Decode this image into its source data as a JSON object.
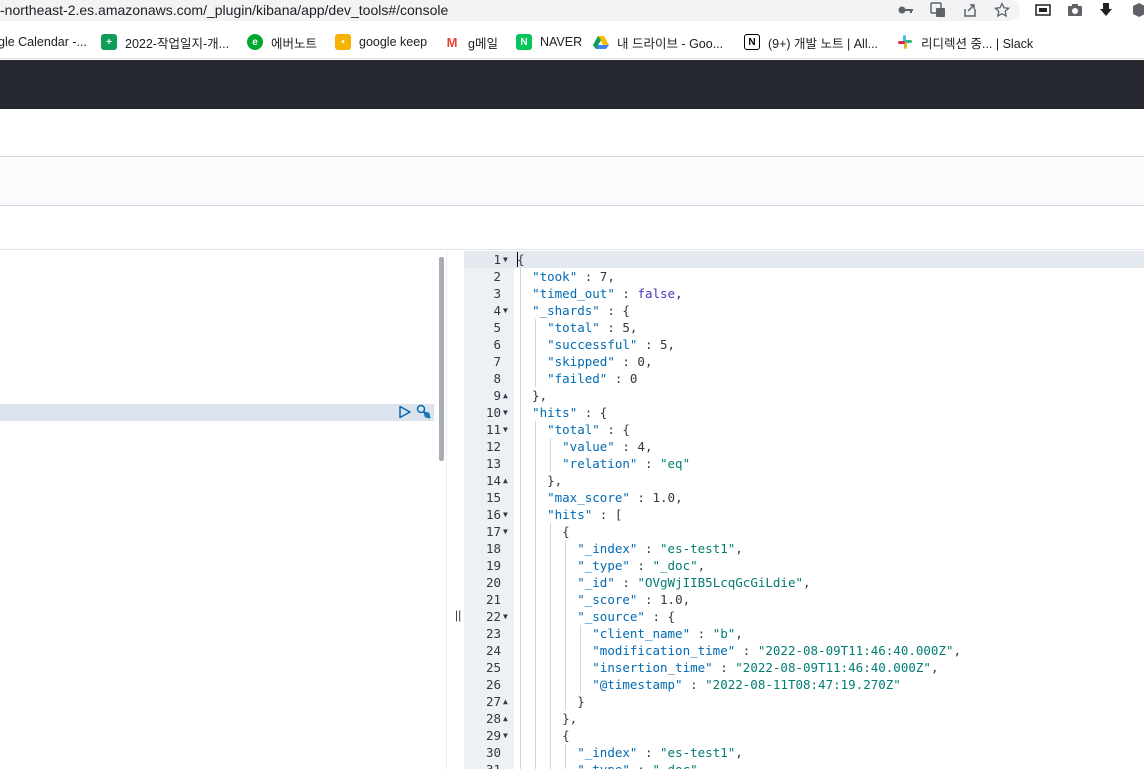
{
  "browser": {
    "url": "-northeast-2.es.amazonaws.com/_plugin/kibana/app/dev_tools#/console",
    "icons": [
      "key-icon",
      "translate-icon",
      "share-icon",
      "star-icon",
      "media-icon",
      "camera-icon",
      "download-icon",
      "extension-icon"
    ]
  },
  "bookmarks": [
    {
      "label": "gle Calendar -...",
      "icon": "calendar-icon",
      "color": ""
    },
    {
      "label": "2022-작업일지-개...",
      "icon": "sheets-icon",
      "color": "#0f9d58",
      "glyph": "+"
    },
    {
      "label": "에버노트",
      "icon": "evernote-icon",
      "color": "#00a82d",
      "glyph": "E"
    },
    {
      "label": "google keep",
      "icon": "keep-icon",
      "color": "#f4b400",
      "glyph": "•"
    },
    {
      "label": "g메일",
      "icon": "gmail-icon",
      "color": "#ea4335",
      "glyph": "M"
    },
    {
      "label": "NAVER",
      "icon": "naver-icon",
      "color": "#03c75a",
      "glyph": "N"
    },
    {
      "label": "내 드라이브 - Goo...",
      "icon": "drive-icon",
      "color": "#4285f4",
      "glyph": "▲"
    },
    {
      "label": "(9+) 개발 노트 | All...",
      "icon": "notion-icon",
      "color": "#000000",
      "glyph": "N"
    },
    {
      "label": "리디렉션 중... | Slack",
      "icon": "slack-icon",
      "color": "#e01e5a",
      "glyph": "#"
    }
  ],
  "output": {
    "lines": [
      {
        "n": "1",
        "fold": "down",
        "segs": [
          [
            "p",
            "{"
          ]
        ]
      },
      {
        "n": "2",
        "fold": "",
        "segs": [
          [
            "p",
            "  "
          ],
          [
            "k",
            "\"took\""
          ],
          [
            "p",
            " : "
          ],
          [
            "n",
            "7"
          ],
          [
            "p",
            ","
          ]
        ]
      },
      {
        "n": "3",
        "fold": "",
        "segs": [
          [
            "p",
            "  "
          ],
          [
            "k",
            "\"timed_out\""
          ],
          [
            "p",
            " : "
          ],
          [
            "b",
            "false"
          ],
          [
            "p",
            ","
          ]
        ]
      },
      {
        "n": "4",
        "fold": "down",
        "segs": [
          [
            "p",
            "  "
          ],
          [
            "k",
            "\"_shards\""
          ],
          [
            "p",
            " : {"
          ]
        ]
      },
      {
        "n": "5",
        "fold": "",
        "segs": [
          [
            "p",
            "    "
          ],
          [
            "k",
            "\"total\""
          ],
          [
            "p",
            " : "
          ],
          [
            "n",
            "5"
          ],
          [
            "p",
            ","
          ]
        ]
      },
      {
        "n": "6",
        "fold": "",
        "segs": [
          [
            "p",
            "    "
          ],
          [
            "k",
            "\"successful\""
          ],
          [
            "p",
            " : "
          ],
          [
            "n",
            "5"
          ],
          [
            "p",
            ","
          ]
        ]
      },
      {
        "n": "7",
        "fold": "",
        "segs": [
          [
            "p",
            "    "
          ],
          [
            "k",
            "\"skipped\""
          ],
          [
            "p",
            " : "
          ],
          [
            "n",
            "0"
          ],
          [
            "p",
            ","
          ]
        ]
      },
      {
        "n": "8",
        "fold": "",
        "segs": [
          [
            "p",
            "    "
          ],
          [
            "k",
            "\"failed\""
          ],
          [
            "p",
            " : "
          ],
          [
            "n",
            "0"
          ]
        ]
      },
      {
        "n": "9",
        "fold": "up",
        "segs": [
          [
            "p",
            "  },"
          ]
        ]
      },
      {
        "n": "10",
        "fold": "down",
        "segs": [
          [
            "p",
            "  "
          ],
          [
            "k",
            "\"hits\""
          ],
          [
            "p",
            " : {"
          ]
        ]
      },
      {
        "n": "11",
        "fold": "down",
        "segs": [
          [
            "p",
            "    "
          ],
          [
            "k",
            "\"total\""
          ],
          [
            "p",
            " : {"
          ]
        ]
      },
      {
        "n": "12",
        "fold": "",
        "segs": [
          [
            "p",
            "      "
          ],
          [
            "k",
            "\"value\""
          ],
          [
            "p",
            " : "
          ],
          [
            "n",
            "4"
          ],
          [
            "p",
            ","
          ]
        ]
      },
      {
        "n": "13",
        "fold": "",
        "segs": [
          [
            "p",
            "      "
          ],
          [
            "k",
            "\"relation\""
          ],
          [
            "p",
            " : "
          ],
          [
            "s",
            "\"eq\""
          ]
        ]
      },
      {
        "n": "14",
        "fold": "up",
        "segs": [
          [
            "p",
            "    },"
          ]
        ]
      },
      {
        "n": "15",
        "fold": "",
        "segs": [
          [
            "p",
            "    "
          ],
          [
            "k",
            "\"max_score\""
          ],
          [
            "p",
            " : "
          ],
          [
            "n",
            "1.0"
          ],
          [
            "p",
            ","
          ]
        ]
      },
      {
        "n": "16",
        "fold": "down",
        "segs": [
          [
            "p",
            "    "
          ],
          [
            "k",
            "\"hits\""
          ],
          [
            "p",
            " : ["
          ]
        ]
      },
      {
        "n": "17",
        "fold": "down",
        "segs": [
          [
            "p",
            "      {"
          ]
        ]
      },
      {
        "n": "18",
        "fold": "",
        "segs": [
          [
            "p",
            "        "
          ],
          [
            "k",
            "\"_index\""
          ],
          [
            "p",
            " : "
          ],
          [
            "s",
            "\"es-test1\""
          ],
          [
            "p",
            ","
          ]
        ]
      },
      {
        "n": "19",
        "fold": "",
        "segs": [
          [
            "p",
            "        "
          ],
          [
            "k",
            "\"_type\""
          ],
          [
            "p",
            " : "
          ],
          [
            "s",
            "\"_doc\""
          ],
          [
            "p",
            ","
          ]
        ]
      },
      {
        "n": "20",
        "fold": "",
        "segs": [
          [
            "p",
            "        "
          ],
          [
            "k",
            "\"_id\""
          ],
          [
            "p",
            " : "
          ],
          [
            "s",
            "\"OVgWjIIB5LcqGcGiLdie\""
          ],
          [
            "p",
            ","
          ]
        ]
      },
      {
        "n": "21",
        "fold": "",
        "segs": [
          [
            "p",
            "        "
          ],
          [
            "k",
            "\"_score\""
          ],
          [
            "p",
            " : "
          ],
          [
            "n",
            "1.0"
          ],
          [
            "p",
            ","
          ]
        ]
      },
      {
        "n": "22",
        "fold": "down",
        "segs": [
          [
            "p",
            "        "
          ],
          [
            "k",
            "\"_source\""
          ],
          [
            "p",
            " : {"
          ]
        ]
      },
      {
        "n": "23",
        "fold": "",
        "segs": [
          [
            "p",
            "          "
          ],
          [
            "k",
            "\"client_name\""
          ],
          [
            "p",
            " : "
          ],
          [
            "s",
            "\"b\""
          ],
          [
            "p",
            ","
          ]
        ]
      },
      {
        "n": "24",
        "fold": "",
        "segs": [
          [
            "p",
            "          "
          ],
          [
            "k",
            "\"modification_time\""
          ],
          [
            "p",
            " : "
          ],
          [
            "s",
            "\"2022-08-09T11:46:40.000Z\""
          ],
          [
            "p",
            ","
          ]
        ]
      },
      {
        "n": "25",
        "fold": "",
        "segs": [
          [
            "p",
            "          "
          ],
          [
            "k",
            "\"insertion_time\""
          ],
          [
            "p",
            " : "
          ],
          [
            "s",
            "\"2022-08-09T11:46:40.000Z\""
          ],
          [
            "p",
            ","
          ]
        ]
      },
      {
        "n": "26",
        "fold": "",
        "segs": [
          [
            "p",
            "          "
          ],
          [
            "k",
            "\"@timestamp\""
          ],
          [
            "p",
            " : "
          ],
          [
            "s",
            "\"2022-08-11T08:47:19.270Z\""
          ]
        ]
      },
      {
        "n": "27",
        "fold": "up",
        "segs": [
          [
            "p",
            "        }"
          ]
        ]
      },
      {
        "n": "28",
        "fold": "up",
        "segs": [
          [
            "p",
            "      },"
          ]
        ]
      },
      {
        "n": "29",
        "fold": "down",
        "segs": [
          [
            "p",
            "      {"
          ]
        ]
      },
      {
        "n": "30",
        "fold": "",
        "segs": [
          [
            "p",
            "        "
          ],
          [
            "k",
            "\"_index\""
          ],
          [
            "p",
            " : "
          ],
          [
            "s",
            "\"es-test1\""
          ],
          [
            "p",
            ","
          ]
        ]
      },
      {
        "n": "31",
        "fold": "",
        "segs": [
          [
            "p",
            "        "
          ],
          [
            "k",
            "\"_type\""
          ],
          [
            "p",
            " : "
          ],
          [
            "s",
            "\"_doc\""
          ],
          [
            "p",
            ","
          ]
        ]
      }
    ]
  }
}
